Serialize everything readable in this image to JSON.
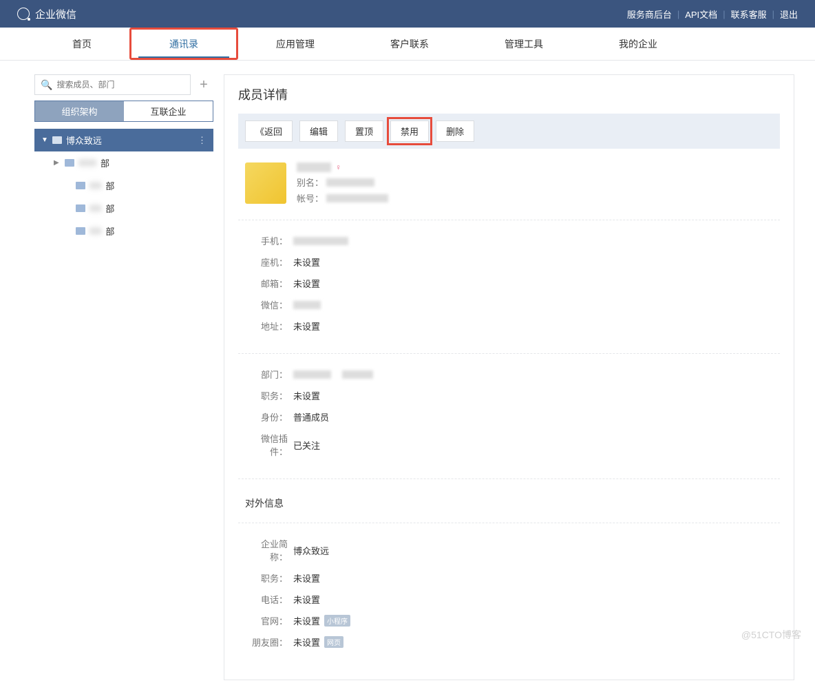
{
  "header": {
    "brand": "企业微信",
    "links": [
      "服务商后台",
      "API文档",
      "联系客服",
      "退出"
    ]
  },
  "nav": {
    "items": [
      "首页",
      "通讯录",
      "应用管理",
      "客户联系",
      "管理工具",
      "我的企业"
    ],
    "active_index": 1
  },
  "sidebar": {
    "search_placeholder": "搜索成员、部门",
    "tabs": [
      "组织架构",
      "互联企业"
    ],
    "root": "博众致远",
    "dept_suffix": "部"
  },
  "main": {
    "title": "成员详情",
    "actions": {
      "back": "《返回",
      "edit": "编辑",
      "top": "置顶",
      "disable": "禁用",
      "delete": "删除"
    },
    "profile": {
      "alias_label": "别名：",
      "account_label": "帐号："
    },
    "fields": {
      "phone": {
        "label": "手机："
      },
      "tel": {
        "label": "座机：",
        "value": "未设置"
      },
      "email": {
        "label": "邮箱：",
        "value": "未设置"
      },
      "wechat": {
        "label": "微信："
      },
      "address": {
        "label": "地址：",
        "value": "未设置"
      },
      "department": {
        "label": "部门："
      },
      "position": {
        "label": "职务：",
        "value": "未设置"
      },
      "identity": {
        "label": "身份：",
        "value": "普通成员"
      },
      "plugin": {
        "label": "微信插件：",
        "value": "已关注"
      }
    },
    "external_title": "对外信息",
    "external": {
      "company": {
        "label": "企业简称：",
        "value": "博众致远"
      },
      "position": {
        "label": "职务：",
        "value": "未设置"
      },
      "phone": {
        "label": "电话：",
        "value": "未设置"
      },
      "website": {
        "label": "官网：",
        "value": "未设置",
        "badge": "小程序"
      },
      "moments": {
        "label": "朋友圈：",
        "value": "未设置",
        "badge": "网页"
      }
    }
  },
  "watermark": "@51CTO博客"
}
